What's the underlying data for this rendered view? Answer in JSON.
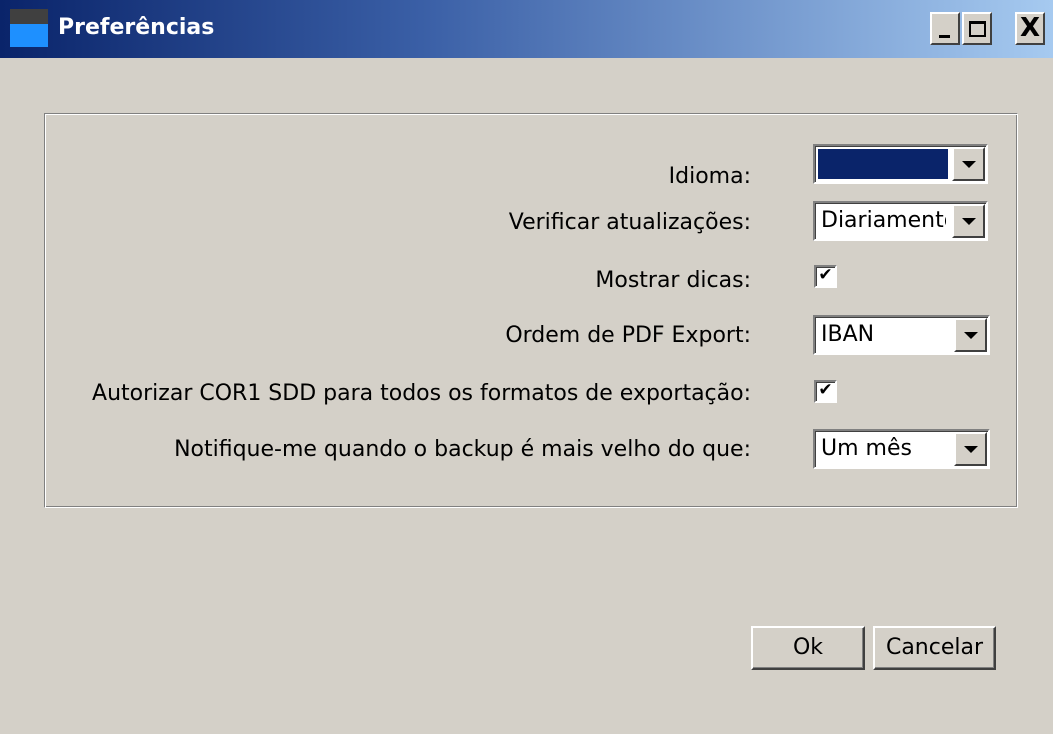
{
  "window": {
    "title": "Preferências",
    "controls": {
      "minimize": "_",
      "maximize": "□",
      "close": "X"
    }
  },
  "form": {
    "language": {
      "label": "Idioma:",
      "value": ""
    },
    "check_updates": {
      "label": "Verificar atualizações:",
      "value": "Diariamento"
    },
    "show_tips": {
      "label": "Mostrar dicas:",
      "checked": true
    },
    "pdf_export_order": {
      "label": "Ordem de PDF Export:",
      "value": "IBAN"
    },
    "authorize_cor1": {
      "label": "Autorizar COR1 SDD para todos os formatos de exportação:",
      "checked": true
    },
    "backup_notify": {
      "label": "Notifique-me quando o backup é mais velho do que:",
      "value": "Um mês"
    }
  },
  "buttons": {
    "ok": "Ok",
    "cancel": "Cancelar"
  },
  "colors": {
    "titlebar_start": "#0a246a",
    "titlebar_end": "#a6caf0",
    "face": "#d4d0c8",
    "selection": "#0a246a"
  },
  "icons": {
    "app": "app-icon",
    "dropdown": "chevron-down-icon",
    "check": "checkmark-icon"
  }
}
